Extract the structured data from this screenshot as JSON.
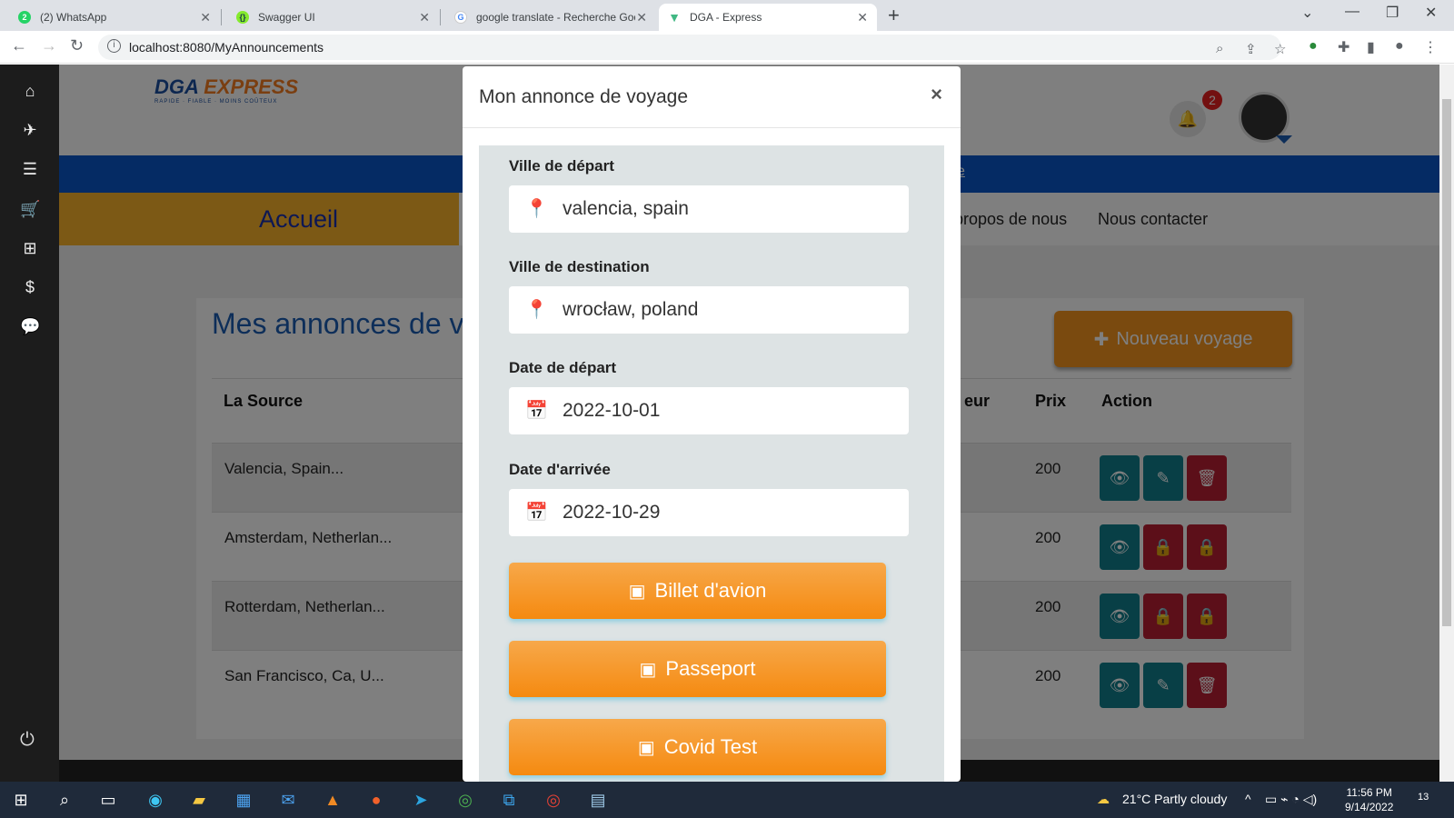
{
  "browser": {
    "tabs": [
      {
        "title": "(2) WhatsApp",
        "icon": "whatsapp-icon",
        "color": "#25d366"
      },
      {
        "title": "Swagger UI",
        "icon": "swagger-icon",
        "color": "#85ea2d"
      },
      {
        "title": "google translate - Recherche Goo",
        "icon": "google-icon",
        "color": "#4285f4"
      },
      {
        "title": "DGA - Express",
        "icon": "vue-icon",
        "color": "#41b883"
      }
    ],
    "url": "localhost:8080/MyAnnouncements"
  },
  "header": {
    "brand_prefix": "DGA",
    "brand_suffix": "EXPRESS",
    "tagline": "RAPIDE · FIABLE · MOINS COÛTEUX",
    "notif_count": "2",
    "bluebar_link": "e"
  },
  "nav": {
    "home": "Accueil",
    "about": "A propos de nous",
    "contact": "Nous contacter"
  },
  "page": {
    "title": "Mes annonces de v",
    "new_trip": "Nouveau voyage",
    "columns": {
      "source": "La Source",
      "partial": "eur",
      "price": "Prix",
      "action": "Action"
    },
    "rows": [
      {
        "source": "Valencia, Spain...",
        "price": "200"
      },
      {
        "source": "Amsterdam, Netherlan...",
        "price": "200"
      },
      {
        "source": "Rotterdam, Netherlan...",
        "price": "200"
      },
      {
        "source": "San Francisco, Ca, U...",
        "price": "200"
      }
    ]
  },
  "modal": {
    "title": "Mon annonce de voyage",
    "close": "×",
    "departure_city_label": "Ville de départ",
    "departure_city": "valencia, spain",
    "destination_city_label": "Ville de destination",
    "destination_city": "wrocław, poland",
    "departure_date_label": "Date de départ",
    "departure_date": "2022-10-01",
    "arrival_date_label": "Date d'arrivée",
    "arrival_date": "2022-10-29",
    "buttons": [
      "Billet d'avion",
      "Passeport",
      "Covid Test"
    ]
  },
  "taskbar": {
    "weather": "21°C  Partly cloudy",
    "time": "11:56 PM",
    "date": "9/14/2022",
    "notifications": "13"
  },
  "colors": {
    "accent": "#f5951e",
    "brand_blue": "#0b57c9",
    "teal": "#107f8c",
    "red": "#b81f33"
  }
}
